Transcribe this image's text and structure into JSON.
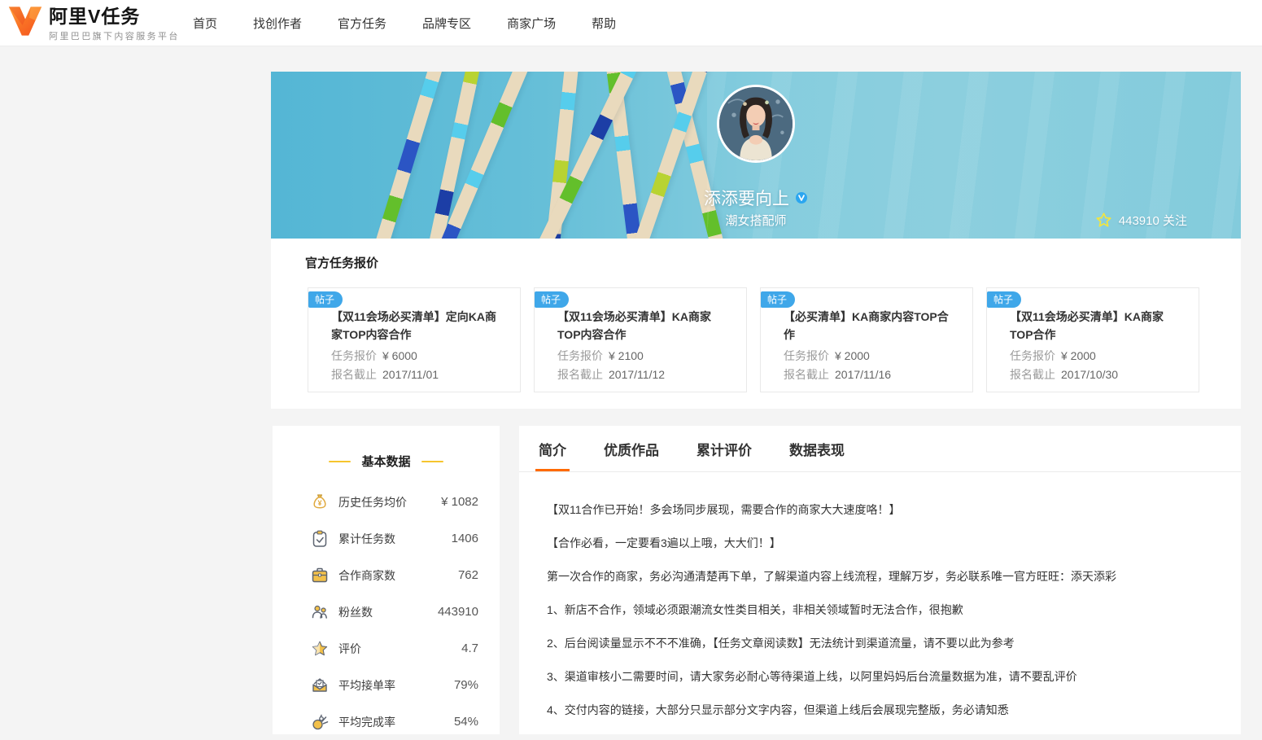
{
  "header": {
    "logo": {
      "title": "阿里V任务",
      "subtitle": "阿里巴巴旗下内容服务平台"
    },
    "nav": [
      "首页",
      "找创作者",
      "官方任务",
      "品牌专区",
      "商家广场",
      "帮助"
    ]
  },
  "profile": {
    "name": "添添要向上",
    "category": "潮女搭配师",
    "followers": "443910 关注"
  },
  "tasks": {
    "section_title": "官方任务报价",
    "price_label": "任务报价",
    "deadline_label": "报名截止",
    "cards": [
      {
        "badge": "帖子",
        "title": "【双11会场必买清单】定向KA商家TOP内容合作",
        "price": "¥ 6000",
        "deadline": "2017/11/01"
      },
      {
        "badge": "帖子",
        "title": "【双11会场必买清单】KA商家TOP内容合作",
        "price": "¥ 2100",
        "deadline": "2017/11/12"
      },
      {
        "badge": "帖子",
        "title": "【必买清单】KA商家内容TOP合作",
        "price": "¥ 2000",
        "deadline": "2017/11/16"
      },
      {
        "badge": "帖子",
        "title": "【双11会场必买清单】KA商家TOP合作",
        "price": "¥ 2000",
        "deadline": "2017/10/30"
      }
    ]
  },
  "stats": {
    "title": "基本数据",
    "items": [
      {
        "icon": "money-bag-icon",
        "label": "历史任务均价",
        "value": "¥ 1082"
      },
      {
        "icon": "clipboard-check-icon",
        "label": "累计任务数",
        "value": "1406"
      },
      {
        "icon": "briefcase-icon",
        "label": "合作商家数",
        "value": "762"
      },
      {
        "icon": "people-icon",
        "label": "粉丝数",
        "value": "443910"
      },
      {
        "icon": "star-icon",
        "label": "评价",
        "value": "4.7"
      },
      {
        "icon": "envelope-check-icon",
        "label": "平均接单率",
        "value": "79%"
      },
      {
        "icon": "ok-hand-icon",
        "label": "平均完成率",
        "value": "54%"
      }
    ]
  },
  "main": {
    "tabs": [
      {
        "label": "简介"
      },
      {
        "label": "优质作品"
      },
      {
        "label": "累计评价"
      },
      {
        "label": "数据表现"
      }
    ],
    "paragraphs": [
      "【双11合作已开始！多会场同步展现，需要合作的商家大大速度咯！】",
      "【合作必看，一定要看3遍以上哦，大大们！】",
      "第一次合作的商家，务必沟通清楚再下单，了解渠道内容上线流程，理解万岁，务必联系唯一官方旺旺：添天添彩",
      "1、新店不合作，领域必须跟潮流女性类目相关，非相关领域暂时无法合作，很抱歉",
      "2、后台阅读量显示不不不准确，【任务文章阅读数】无法统计到渠道流量，请不要以此为参考",
      "3、渠道审核小二需要时间，请大家务必耐心等待渠道上线，以阿里妈妈后台流量数据为准，请不要乱评价",
      "4、交付内容的链接，大部分只显示部分文字内容，但渠道上线后会展现完整版，务必请知悉"
    ]
  },
  "colors": {
    "accent_orange": "#ff6a00",
    "badge_blue": "#3fa7e9",
    "banner_blue": "#7cc9dc",
    "star_yellow": "#f3e53e",
    "icon_gold": "#f2c04a",
    "dash_gold": "#f6c52e"
  }
}
